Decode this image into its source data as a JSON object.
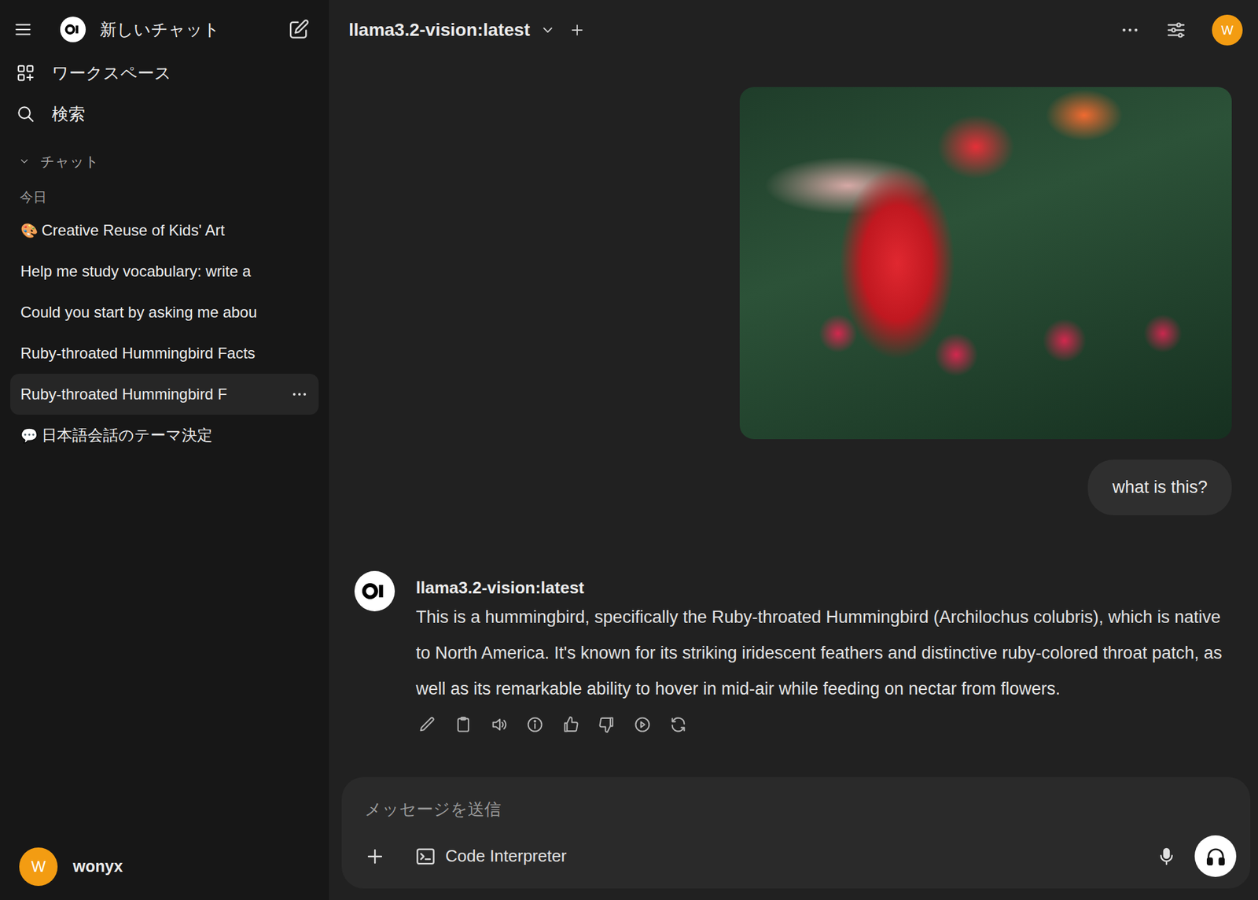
{
  "sidebar": {
    "new_chat": "新しいチャット",
    "nav": [
      {
        "label": "ワークスペース"
      },
      {
        "label": "検索"
      }
    ],
    "section": {
      "label": "チャット",
      "expanded": true
    },
    "group": "今日",
    "chats": [
      {
        "emoji": "🎨",
        "label": "Creative Reuse of Kids' Art",
        "selected": false
      },
      {
        "label": "Help me study vocabulary: write a",
        "selected": false
      },
      {
        "label": "Could you start by asking me abou",
        "selected": false
      },
      {
        "label": "Ruby-throated Hummingbird Facts",
        "selected": false
      },
      {
        "label": "Ruby-throated Hummingbird F",
        "selected": true
      },
      {
        "emoji": "💬",
        "label": "日本語会話のテーマ決定",
        "selected": false
      }
    ],
    "user": {
      "avatar": "W",
      "name": "wonyx"
    }
  },
  "header": {
    "model": "llama3.2-vision:latest",
    "avatar": "W"
  },
  "messages": [
    {
      "role": "user",
      "kind": "image"
    },
    {
      "role": "user",
      "kind": "text",
      "text": "what is this?"
    },
    {
      "role": "assistant",
      "kind": "text",
      "name": "llama3.2-vision:latest",
      "text": "This is a hummingbird, specifically the Ruby-throated Hummingbird (Archilochus colubris), which is native to North America. It's known for its striking iridescent feathers and distinctive ruby-colored throat patch, as well as its remarkable ability to hover in mid-air while feeding on nectar from flowers."
    }
  ],
  "composer": {
    "placeholder": "メッセージを送信",
    "tool": "Code Interpreter"
  }
}
